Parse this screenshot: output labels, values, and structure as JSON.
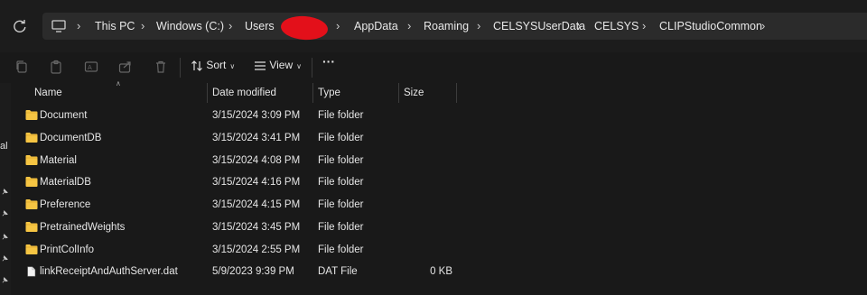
{
  "breadcrumb": {
    "items": [
      "This PC",
      "Windows (C:)",
      "Users",
      "AppData",
      "Roaming",
      "CELSYSUserData",
      "CELSYS",
      "CLIPStudioCommon"
    ]
  },
  "toolbar": {
    "sort_label": "Sort",
    "view_label": "View",
    "more_label": "···"
  },
  "nav": {
    "partial_label": "al"
  },
  "columns": {
    "name": "Name",
    "date": "Date modified",
    "type": "Type",
    "size": "Size"
  },
  "files": [
    {
      "name": "Document",
      "date": "3/15/2024 3:09 PM",
      "type": "File folder",
      "size": "",
      "icon": "folder-icon"
    },
    {
      "name": "DocumentDB",
      "date": "3/15/2024 3:41 PM",
      "type": "File folder",
      "size": "",
      "icon": "folder-icon"
    },
    {
      "name": "Material",
      "date": "3/15/2024 4:08 PM",
      "type": "File folder",
      "size": "",
      "icon": "folder-icon"
    },
    {
      "name": "MaterialDB",
      "date": "3/15/2024 4:16 PM",
      "type": "File folder",
      "size": "",
      "icon": "folder-icon"
    },
    {
      "name": "Preference",
      "date": "3/15/2024 4:15 PM",
      "type": "File folder",
      "size": "",
      "icon": "folder-icon"
    },
    {
      "name": "PretrainedWeights",
      "date": "3/15/2024 3:45 PM",
      "type": "File folder",
      "size": "",
      "icon": "folder-icon"
    },
    {
      "name": "PrintColInfo",
      "date": "3/15/2024 2:55 PM",
      "type": "File folder",
      "size": "",
      "icon": "folder-icon"
    },
    {
      "name": "linkReceiptAndAuthServer.dat",
      "date": "5/9/2023 9:39 PM",
      "type": "DAT File",
      "size": "0 KB",
      "icon": "file-icon"
    }
  ],
  "colors": {
    "folder": "#f6c543",
    "redaction": "#e3101a",
    "background": "#191919"
  }
}
